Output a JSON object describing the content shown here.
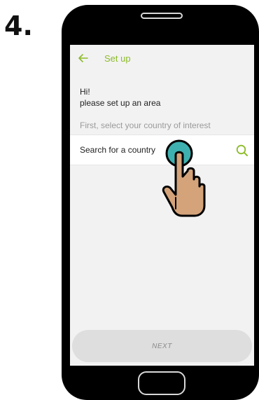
{
  "step": {
    "label": "4."
  },
  "appbar": {
    "back_icon": "arrow-left-icon",
    "title": "Set up"
  },
  "content": {
    "greeting": "Hi!",
    "subtitle": "please set up an area",
    "hint": "First, select your country of interest"
  },
  "search": {
    "placeholder": "Search for a country",
    "value": "",
    "icon": "search-icon"
  },
  "footer": {
    "next_label": "NEXT"
  },
  "overlay": {
    "icon": "tap-hand-icon"
  },
  "colors": {
    "accent": "#8dbb2a",
    "screen_background": "#f2f2f2",
    "next_button_background": "#dedede",
    "touch_indicator": "#3fb0b0"
  }
}
